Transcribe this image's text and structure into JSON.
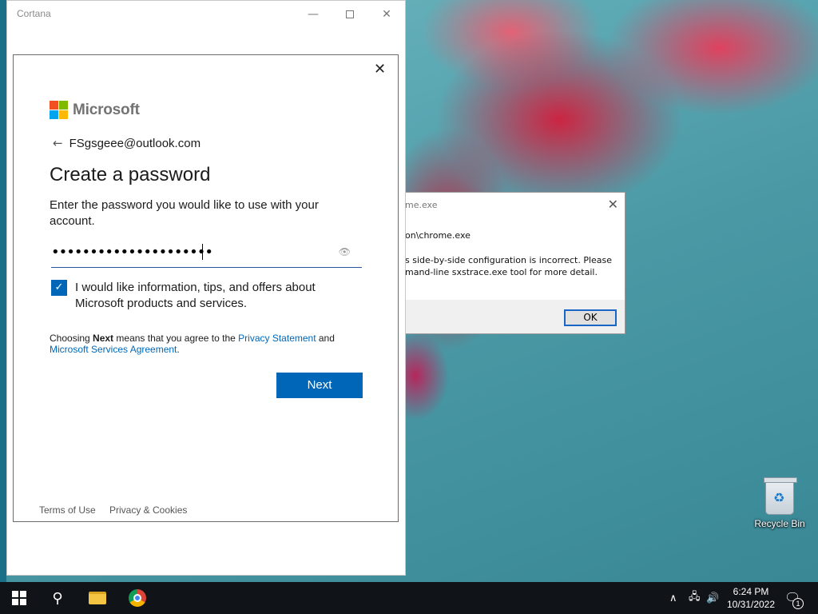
{
  "cortana": {
    "title": "Cortana",
    "window_controls": {
      "minimize": "—",
      "close": "✕"
    }
  },
  "signin": {
    "close_glyph": "✕",
    "brand": "Microsoft",
    "back_glyph": "←",
    "email": "FSgsgeee@outlook.com",
    "heading": "Create a password",
    "description": "Enter the password you would like to use with your account.",
    "password_mask": "•••••••••••••••••••••",
    "show_password_glyph": "👁",
    "checkbox_checked": true,
    "checkbox_glyph": "✓",
    "consent_text": "I would like information, tips, and offers about Microsoft products and services.",
    "terms": {
      "prefix": "Choosing ",
      "next_word": "Next",
      "middle": " means that you agree to the ",
      "privacy_link": "Privacy Statement",
      "and": " and",
      "services_link": "Microsoft Services Agreement",
      "suffix": "."
    },
    "next_label": "Next",
    "footer_terms": "Terms of Use",
    "footer_privacy": "Privacy & Cookies"
  },
  "error_dialog": {
    "title": "me.exe",
    "close_glyph": "✕",
    "path": "on\\chrome.exe",
    "message": "s side-by-side configuration is incorrect. Please\nmand-line sxstrace.exe tool for more detail.",
    "ok_label": "OK"
  },
  "desktop": {
    "recycle_bin_label": "Recycle Bin",
    "recycle_glyph": "♻"
  },
  "taskbar": {
    "search_glyph": "⚲",
    "tray_chevron": "∧",
    "tray_network": "🖧",
    "tray_volume": "🔊",
    "time": "6:24 PM",
    "date": "10/31/2022",
    "notification_glyph": "🗨",
    "notification_count": "1"
  },
  "colors": {
    "accent": "#0067b8",
    "taskbar": "#101418"
  }
}
